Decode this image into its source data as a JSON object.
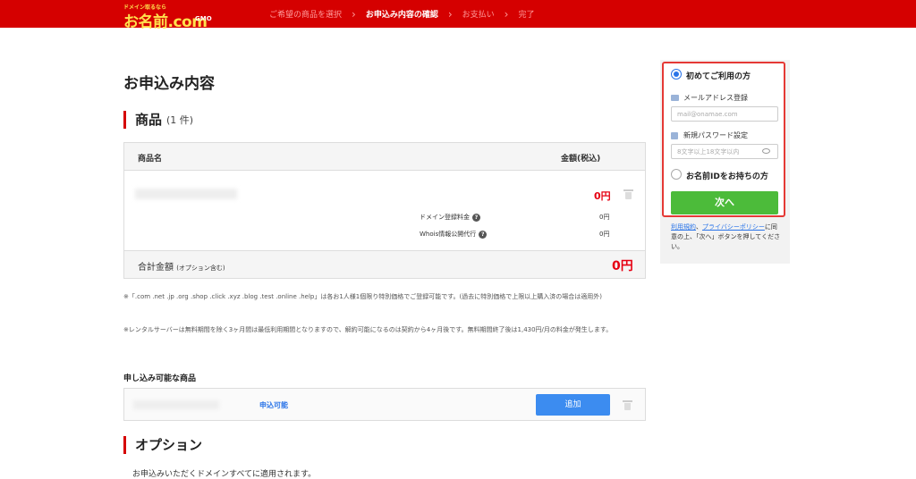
{
  "header": {
    "logo_tagline": "ドメイン取るなら",
    "logo_text": "お名前.com",
    "logo_sub": "GMO",
    "steps": [
      "ご希望の商品を選択",
      "お申込み内容の確認",
      "お支払い",
      "完了"
    ],
    "active_step": 1
  },
  "main": {
    "page_title": "お申込み内容",
    "products_section": {
      "title": "商品",
      "count": "(1 件)"
    },
    "table": {
      "col_name": "商品名",
      "col_price": "金額(税込)",
      "item_price": "0円",
      "fees": [
        {
          "label": "ドメイン登録料金",
          "value": "0円"
        },
        {
          "label": "Whois情報公開代行",
          "value": "0円"
        }
      ],
      "total_label": "合計金額",
      "total_note": "(オプション含む)",
      "total_value": "0円"
    },
    "notes": [
      "※「.com .net .jp .org .shop .click .xyz .blog .test .online .help」は各お1人様1個限り特別価格でご登録可能です。(過去に特別価格で上限以上購入済の場合は適用外)",
      "※レンタルサーバーは無料期間を除く3ヶ月間は最低利用期間となりますので、解約可能になるのは契約から4ヶ月後です。無料期間終了後は1,430円/月の料金が発生します。"
    ],
    "available": {
      "title": "申し込み可能な商品",
      "status": "申込可能",
      "add_label": "追加"
    },
    "option_section": {
      "title": "オプション",
      "desc": "お申込みいただくドメインすべてに適用されます。"
    }
  },
  "sidebar": {
    "first_time_label": "初めてご利用の方",
    "email_label": "メールアドレス登録",
    "email_placeholder": "mail@onamae.com",
    "password_label": "新規パスワード設定",
    "password_placeholder": "8文字以上18文字以内",
    "has_id_label": "お名前IDをお持ちの方",
    "next_label": "次へ",
    "terms_link": "利用規約",
    "terms_sep": "、",
    "privacy_link": "プライバシーポリシー",
    "terms_suffix": "に同意の上、「次へ」ボタンを押してください。"
  },
  "colors": {
    "brand_red": "#d50000",
    "price_red": "#e60012",
    "next_green": "#4cbb3a",
    "add_blue": "#3c8cf0"
  }
}
